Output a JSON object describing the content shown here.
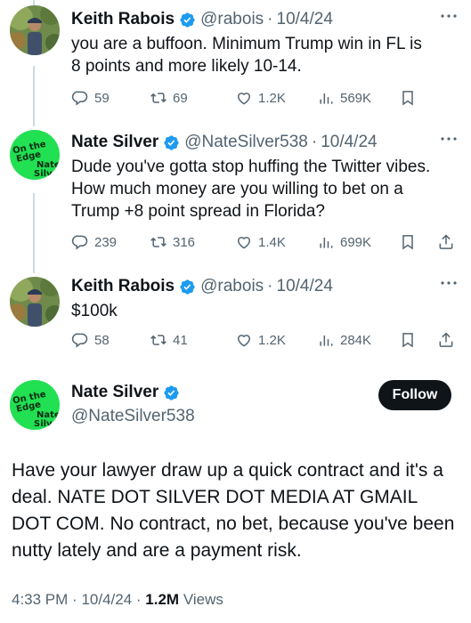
{
  "tweets": [
    {
      "name": "Keith Rabois",
      "handle": "@rabois",
      "date": "10/4/24",
      "text_lines": [
        "you are a buffoon.  Minimum Trump win in FL is",
        "8 points and more likely 10-14."
      ],
      "replies": "59",
      "retweets": "69",
      "likes": "1.2K",
      "views": "569K"
    },
    {
      "name": "Nate Silver",
      "handle": "@NateSilver538",
      "date": "10/4/24",
      "text_lines": [
        "Dude you've gotta stop huffing the Twitter vibes.",
        "How much money are you willing to bet on a",
        "Trump +8 point spread in Florida?"
      ],
      "replies": "239",
      "retweets": "316",
      "likes": "1.4K",
      "views": "699K"
    },
    {
      "name": "Keith Rabois",
      "handle": "@rabois",
      "date": "10/4/24",
      "text_lines": [
        "$100k"
      ],
      "replies": "58",
      "retweets": "41",
      "likes": "1.2K",
      "views": "284K"
    }
  ],
  "main_tweet": {
    "name": "Nate Silver",
    "handle": "@NateSilver538",
    "follow_label": "Follow",
    "text": "Have your lawyer draw up a quick contract and it's a deal. NATE DOT SILVER DOT MEDIA AT GMAIL DOT COM. No contract, no bet, because you've been nutty lately and are a payment risk.",
    "time": "4:33 PM",
    "date": "10/4/24",
    "views_count": "1.2M",
    "views_label": "Views"
  },
  "avatar_badge": {
    "line1": "On the",
    "line2": "Edge",
    "line3": "Nate",
    "line4": "Silver"
  },
  "colors": {
    "verified": "#1d9bf0",
    "muted": "#536471",
    "thread_line": "#cfd9de",
    "nate_avatar": "#21e052"
  },
  "icons": [
    "reply-icon",
    "retweet-icon",
    "like-icon",
    "views-icon",
    "bookmark-icon",
    "share-icon",
    "verified-badge-icon",
    "more-icon"
  ]
}
